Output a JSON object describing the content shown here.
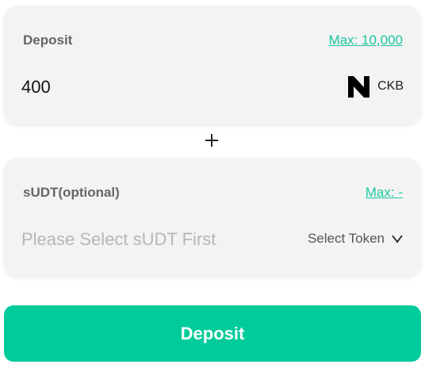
{
  "colors": {
    "accent": "#00cc9b",
    "link": "#19c7a0",
    "card_bg": "#f3f3f3",
    "title": "#666666"
  },
  "deposit_card": {
    "title": "Deposit",
    "max_label": "Max: 10,000",
    "amount_value": "400",
    "token_icon": "nervos-ckb-logo-icon",
    "token_name": "CKB"
  },
  "separator_icon": "plus-icon",
  "sudt_card": {
    "title": "sUDT(optional)",
    "max_label": "Max: -",
    "amount_placeholder": "Please Select sUDT First",
    "select_label": "Select Token",
    "select_icon": "chevron-down-icon"
  },
  "deposit_button": {
    "label": "Deposit"
  }
}
